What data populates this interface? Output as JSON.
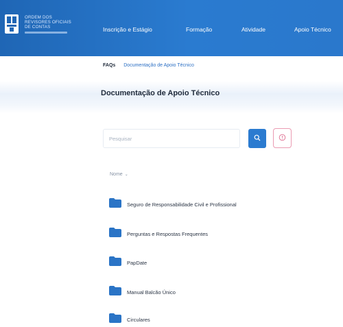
{
  "header": {
    "brand_text_lines": [
      "ORDEM DOS",
      "REVISORES OFICIAIS",
      "DE CONTAS"
    ],
    "nav": [
      {
        "label": "Inscrição e Estágio"
      },
      {
        "label": "Formação"
      },
      {
        "label": "Atividade"
      },
      {
        "label": "Apoio Técnico"
      }
    ]
  },
  "breadcrumb": {
    "items": [
      {
        "label": "FAQs"
      },
      {
        "label": "Documentação de Apoio Técnico"
      }
    ]
  },
  "main": {
    "title": "Documentação de Apoio Técnico",
    "search": {
      "placeholder": "Pesquisar",
      "value": ""
    },
    "sort_label": "Nome",
    "folders": [
      {
        "label": "Seguro de Responsabilidade Civil e Profissional"
      },
      {
        "label": "Perguntas e Respostas Frequentes"
      },
      {
        "label": "PapDate"
      },
      {
        "label": "Manual Balcão Único"
      },
      {
        "label": "Circulares"
      }
    ]
  },
  "colors": {
    "header_blue": "#2a7bd0",
    "accent_blue": "#2b7bd0",
    "clear_button_border": "#ea9bb2",
    "folder_blue": "#2a74c6"
  },
  "icons": {
    "logo": "shield-logo-icon",
    "search": "search-icon",
    "clear": "clear-icon",
    "sort": "chevron-down-icon",
    "folder": "folder-icon"
  }
}
